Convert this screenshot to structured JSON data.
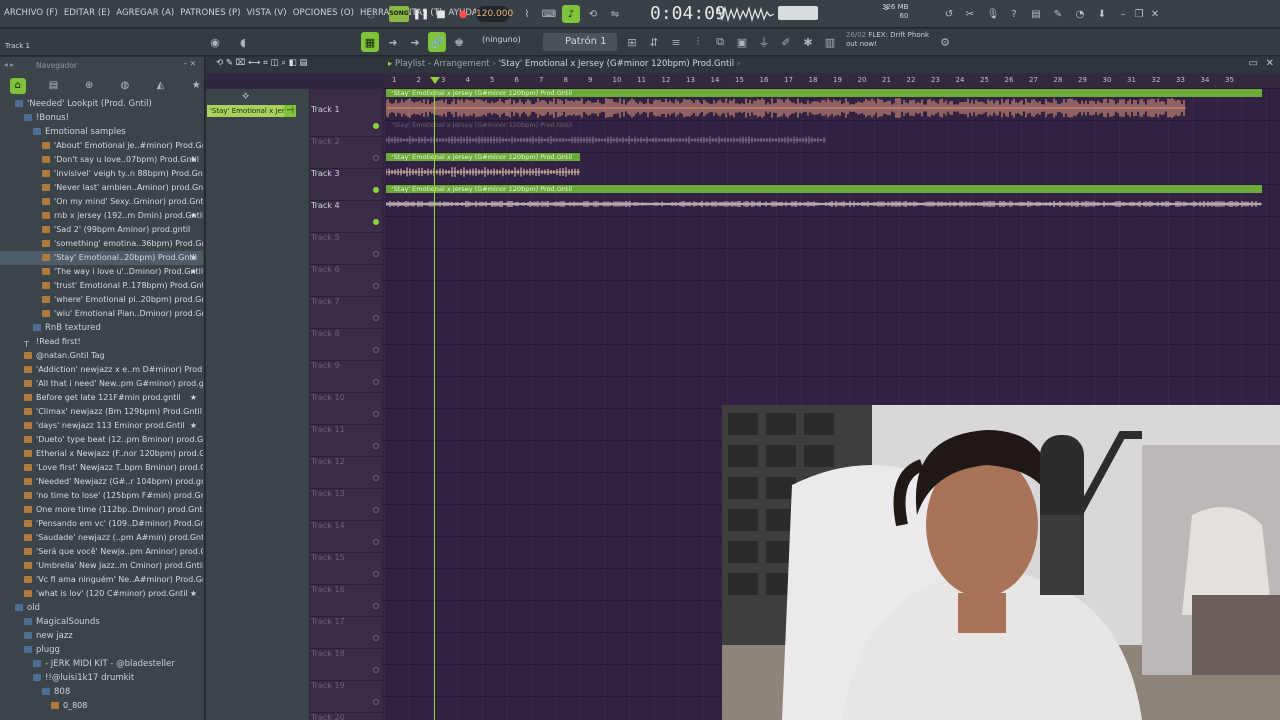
{
  "menu": [
    "ARCHIVO (F)",
    "EDITAR (E)",
    "AGREGAR (A)",
    "PATRONES (P)",
    "VISTA (V)",
    "OPCIONES (O)",
    "HERRAMIENTAS (T)",
    "AYUDA"
  ],
  "transport": {
    "mode": "SONG",
    "tempo": "120.000",
    "time": "0:04:09",
    "memory": "326 MB",
    "cpu": "3",
    "voices": "60"
  },
  "hint": "Track 1",
  "toolbar2": {
    "pattern_none": "(ninguno)",
    "pattern": "Patrón 1",
    "news_date": "26/02",
    "news_line1": "FLEX: Drift Phonk",
    "news_line2": "out now!"
  },
  "browser": {
    "title": "Navegador",
    "items": [
      {
        "label": "'Needed' Lookpit (Prod. Gntil)",
        "kind": "folder",
        "indent": 1
      },
      {
        "label": "!Bonus!",
        "kind": "folder",
        "indent": 2
      },
      {
        "label": "Emotional samples",
        "kind": "folder",
        "indent": 3
      },
      {
        "label": "'About' Emotional je..#minor) Prod.Gntil",
        "kind": "file",
        "indent": 4
      },
      {
        "label": "'Don't say u love..07bpm) Prod.Gntil",
        "kind": "file",
        "indent": 4,
        "star": true
      },
      {
        "label": "'invisivel' veigh ty..n 88bpm) Prod.Gntil",
        "kind": "file",
        "indent": 4
      },
      {
        "label": "'Never last' ambien..Aminor) prod.Gntil",
        "kind": "file",
        "indent": 4
      },
      {
        "label": "'On my mind' Sexy..Gminor) prod.Gntil",
        "kind": "file",
        "indent": 4
      },
      {
        "label": "rnb x jersey (192..m Dmin) prod.Gntil",
        "kind": "file",
        "indent": 4,
        "star": true
      },
      {
        "label": "'Sad 2' (99bpm Aminor) prod.gntil",
        "kind": "file",
        "indent": 4
      },
      {
        "label": "'something' emotina..36bpm) Prod.Gntil",
        "kind": "file",
        "indent": 4
      },
      {
        "label": "'Stay' Emotional..20bpm) Prod.Gntil",
        "kind": "file",
        "indent": 4,
        "star": true,
        "selected": true
      },
      {
        "label": "'The way i love u'..Dminor) Prod.Gntil",
        "kind": "file",
        "indent": 4,
        "star": true
      },
      {
        "label": "'trust' Emotional P..178bpm) Prod.Gntil",
        "kind": "file",
        "indent": 4
      },
      {
        "label": "'where' Emotional pi..20bpm) prod.Gntil",
        "kind": "file",
        "indent": 4
      },
      {
        "label": "'wiu' Emotional Pian..Dminor) prod.Gntil",
        "kind": "file",
        "indent": 4
      },
      {
        "label": "RnB textured",
        "kind": "folder",
        "indent": 3
      },
      {
        "label": "!Read first!",
        "kind": "txt",
        "indent": 2
      },
      {
        "label": "@natan.Gntil Tag",
        "kind": "file",
        "indent": 2
      },
      {
        "label": "'Addiction' newjazz x e..m D#minor) Prod.Gntil",
        "kind": "file",
        "indent": 2
      },
      {
        "label": "'All that i need' New..pm G#minor) prod.gntil",
        "kind": "file",
        "indent": 2
      },
      {
        "label": "Before get late 121F#min prod.gntil",
        "kind": "file",
        "indent": 2,
        "star": true
      },
      {
        "label": "'Climax' newjazz (Bm 129bpm) Prod.Gntil",
        "kind": "file",
        "indent": 2
      },
      {
        "label": "'days' newjazz 113 Eminor prod.Gntil",
        "kind": "file",
        "indent": 2,
        "star": true
      },
      {
        "label": "'Dueto' type beat (12..pm Bminor) prod.Gntil",
        "kind": "file",
        "indent": 2
      },
      {
        "label": "Etherial x Newjazz (F..nor 120bpm) prod.Gntil",
        "kind": "file",
        "indent": 2
      },
      {
        "label": "'Love first' Newjazz T..bpm Bminor) prod.Gntil",
        "kind": "file",
        "indent": 2
      },
      {
        "label": "'Needed' Newjazz (G#..r 104bpm) prod.gntil",
        "kind": "file",
        "indent": 2
      },
      {
        "label": "'no time to lose' (125bpm F#min) prod.Gntil",
        "kind": "file",
        "indent": 2
      },
      {
        "label": "One more time (112bp..Dminor) prod.Gntil",
        "kind": "file",
        "indent": 2
      },
      {
        "label": "'Pensando em vc' (109..D#minor) Prod.Gntil",
        "kind": "file",
        "indent": 2
      },
      {
        "label": "'Saudade' newjazz (..pm A#min) prod.Gntil",
        "kind": "file",
        "indent": 2
      },
      {
        "label": "'Será que você' Newja..pm Aminor) prod.Gntil",
        "kind": "file",
        "indent": 2
      },
      {
        "label": "'Umbrella' New Jazz..m Cminor) prod.Gntil",
        "kind": "file",
        "indent": 2
      },
      {
        "label": "'Vc fi ama ninguém' Ne..A#minor) Prod.Gntil",
        "kind": "file",
        "indent": 2
      },
      {
        "label": "'what is lov' (120 C#minor) prod.Gntil",
        "kind": "file",
        "indent": 2,
        "star": true
      },
      {
        "label": "old",
        "kind": "folder",
        "indent": 1
      },
      {
        "label": "MagicalSounds",
        "kind": "folder",
        "indent": 2
      },
      {
        "label": "new jazz",
        "kind": "folder",
        "indent": 2
      },
      {
        "label": "plugg",
        "kind": "folder",
        "indent": 2
      },
      {
        "label": "- JERK MIDI KIT - @bladesteller",
        "kind": "folder",
        "indent": 3
      },
      {
        "label": "!!@luisi1k17 drumkit",
        "kind": "folder",
        "indent": 3
      },
      {
        "label": "808",
        "kind": "folder",
        "indent": 4
      },
      {
        "label": "0_808",
        "kind": "file",
        "indent": 5
      }
    ]
  },
  "playlist": {
    "title_prefix": "Playlist - Arrangement",
    "title": "'Stay' Emotional x Jersey (G#minor 120bpm) Prod.Gntil",
    "picker_clip": "'Stay' Emotional x Jers..",
    "ruler": [
      "1",
      "2",
      "3",
      "4",
      "5",
      "6",
      "7",
      "8",
      "9",
      "10",
      "11",
      "12",
      "13",
      "14",
      "15",
      "16",
      "17",
      "18",
      "19",
      "20",
      "21",
      "22",
      "23",
      "24",
      "25",
      "26",
      "27",
      "28",
      "29",
      "30",
      "31",
      "32",
      "33",
      "34",
      "35"
    ],
    "tracks": [
      {
        "name": "Track 1",
        "active": true
      },
      {
        "name": "Track 2",
        "active": false
      },
      {
        "name": "Track 3",
        "active": true
      },
      {
        "name": "Track 4",
        "active": true
      },
      {
        "name": "Track 5",
        "active": false
      },
      {
        "name": "Track 6",
        "active": false
      },
      {
        "name": "Track 7",
        "active": false
      },
      {
        "name": "Track 8",
        "active": false
      },
      {
        "name": "Track 9",
        "active": false
      },
      {
        "name": "Track 10",
        "active": false
      },
      {
        "name": "Track 11",
        "active": false
      },
      {
        "name": "Track 12",
        "active": false
      },
      {
        "name": "Track 13",
        "active": false
      },
      {
        "name": "Track 14",
        "active": false
      },
      {
        "name": "Track 15",
        "active": false
      },
      {
        "name": "Track 16",
        "active": false
      },
      {
        "name": "Track 17",
        "active": false
      },
      {
        "name": "Track 18",
        "active": false
      },
      {
        "name": "Track 19",
        "active": false
      },
      {
        "name": "Track 20",
        "active": false
      }
    ],
    "clip_label": "'Stay' Emotional x Jersey (G#minor 120bpm) Prod.Gntil"
  },
  "colors": {
    "accent": "#7fc33a",
    "waveform": "#f0a080",
    "clip_bar": "#6cab3a",
    "lane_bg": "#302240"
  }
}
